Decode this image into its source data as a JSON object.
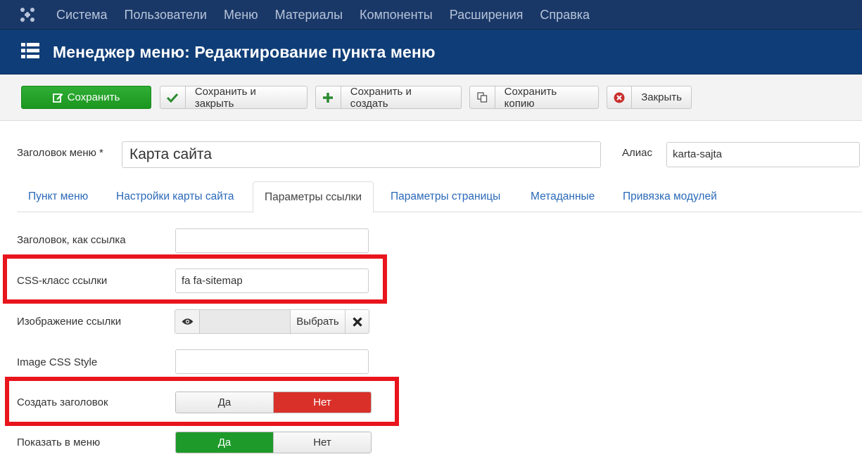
{
  "topnav": {
    "items": [
      "Система",
      "Пользователи",
      "Меню",
      "Материалы",
      "Компоненты",
      "Расширения",
      "Справка"
    ]
  },
  "header": {
    "title": "Менеджер меню: Редактирование пункта меню"
  },
  "toolbar": {
    "save": "Сохранить",
    "save_close": "Сохранить и закрыть",
    "save_new": "Сохранить и создать",
    "save_copy": "Сохранить копию",
    "close": "Закрыть"
  },
  "form": {
    "title_label": "Заголовок меню *",
    "title_value": "Карта сайта",
    "alias_label": "Алиас",
    "alias_value": "karta-sajta"
  },
  "tabs": [
    "Пункт меню",
    "Настройки карты сайта",
    "Параметры ссылки",
    "Параметры страницы",
    "Метаданные",
    "Привязка модулей"
  ],
  "active_tab": "Параметры ссылки",
  "fields": {
    "link_title_label": "Заголовок, как ссылка",
    "link_title_value": "",
    "css_class_label": "CSS-класс ссылки",
    "css_class_value": "fa fa-sitemap",
    "image_label": "Изображение ссылки",
    "image_select": "Выбрать",
    "image_css_label": "Image CSS Style",
    "image_css_value": "",
    "add_title_label": "Создать заголовок",
    "add_title_yes": "Да",
    "add_title_no": "Нет",
    "add_title_selected": "Нет",
    "show_menu_label": "Показать в меню",
    "show_menu_yes": "Да",
    "show_menu_no": "Нет",
    "show_menu_selected": "Да"
  },
  "colors": {
    "topnav_bg": "#1a3867",
    "header_bg": "#0f3d77",
    "save_green": "#2fae36",
    "toggle_no_red": "#d9312a",
    "toggle_yes_green": "#1e9a2a",
    "highlight_red": "#e8151c",
    "tab_link": "#2a69b8"
  },
  "icons": {
    "logo": "joomla-logo-icon",
    "header": "list-icon",
    "save": "edit-icon",
    "save_close": "check-icon",
    "save_new": "plus-icon",
    "save_copy": "copy-icon",
    "close": "close-circle-icon",
    "preview": "eye-icon",
    "clear": "x-icon"
  }
}
